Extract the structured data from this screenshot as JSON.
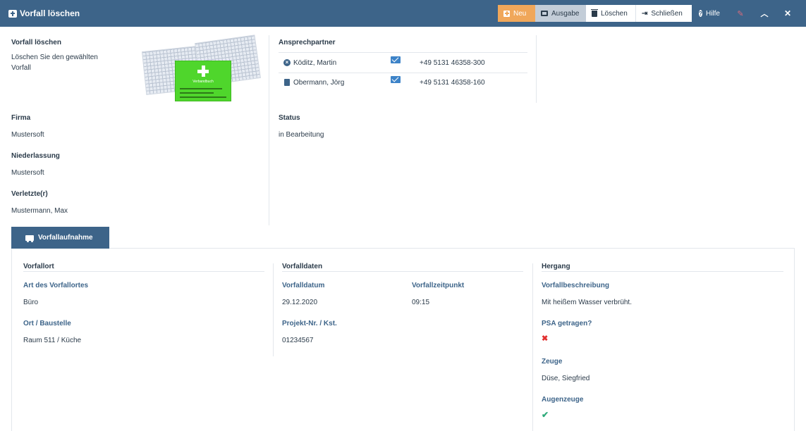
{
  "header": {
    "title": "Vorfall löschen",
    "buttons": {
      "new": "Neu",
      "output": "Ausgabe",
      "delete": "Löschen",
      "close": "Schließen",
      "help": "Hilfe"
    },
    "colors": {
      "bar": "#3d6489",
      "new": "#f0a75a",
      "output": "#c3cdd8"
    }
  },
  "intro": {
    "heading": "Vorfall löschen",
    "text_line1": "Löschen Sie den gewählten",
    "text_line2": "Vorfall",
    "image_label": "Verbandbuch"
  },
  "contacts": {
    "heading": "Ansprechpartner",
    "rows": [
      {
        "icon": "circle-x-icon",
        "name": "Köditz, Martin",
        "mail_icon": "envelope-icon",
        "phone": "+49 5131 46358-300"
      },
      {
        "icon": "book-icon",
        "name": "Obermann, Jörg",
        "mail_icon": "envelope-icon",
        "phone": "+49 5131 46358-160"
      }
    ]
  },
  "details": {
    "company_label": "Firma",
    "company": "Mustersoft",
    "branch_label": "Niederlassung",
    "branch": "Mustersoft",
    "injured_label": "Verletzte(r)",
    "injured": "Mustermann, Max",
    "status_label": "Status",
    "status": "in Bearbeitung"
  },
  "tab": {
    "label": "Vorfallaufnahme",
    "icon": "truck-icon"
  },
  "incident": {
    "location": {
      "heading": "Vorfallort",
      "type_label": "Art des Vorfallortes",
      "type": "Büro",
      "site_label": "Ort / Baustelle",
      "site": "Raum 511 / Küche"
    },
    "data": {
      "heading": "Vorfalldaten",
      "date_label": "Vorfalldatum",
      "date": "29.12.2020",
      "time_label": "Vorfallzeitpunkt",
      "time": "09:15",
      "project_label": "Projekt-Nr. / Kst.",
      "project": "01234567"
    },
    "course": {
      "heading": "Hergang",
      "desc_label": "Vorfallbeschreibung",
      "desc": "Mit heißem Wasser verbrüht.",
      "ppe_label": "PSA getragen?",
      "ppe_value": false,
      "witness_label": "Zeuge",
      "witness": "Düse, Siegfried",
      "eyewitness_label": "Augenzeuge",
      "eyewitness_value": true
    }
  }
}
